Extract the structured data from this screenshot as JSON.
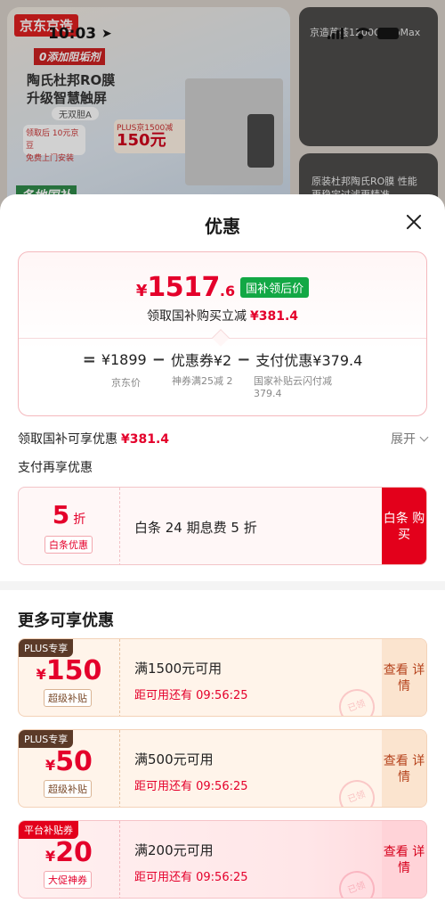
{
  "status_bar": {
    "time": "10:03",
    "location_icon": "location-arrow-icon"
  },
  "background": {
    "brand": "京东京造",
    "zero_tag": "0添加阻垢剂",
    "title": "陶氏杜邦RO膜 升级智慧触屏",
    "sub": "无双胆A",
    "card1": "领取后 10元京豆",
    "card1b": "免费上门安装",
    "card2_label": "PLUS京1500减",
    "card2_amount": "150元",
    "national": "各地国补",
    "right_top": "京造芦荟1200G ProMax",
    "right_bottom": "原装杜邦陶氏RO膜 性能更稳定过滤更精准"
  },
  "sheet": {
    "title": "优惠",
    "summary": {
      "currency": "¥",
      "price_int": "1517",
      "price_dec": ".6",
      "price_tag": "国补领后价",
      "save_label": "领取国补购买立减",
      "save_amount": "¥381.4",
      "formula": {
        "eq": "=",
        "term1": "¥1899",
        "minus1": "−",
        "term2": "优惠券¥2",
        "minus2": "−",
        "term3": "支付优惠¥379.4"
      },
      "labels": {
        "l1": "京东价",
        "l2": "神券满25减 2",
        "l3": "国家补贴云闪付减 379.4"
      }
    },
    "guobu_row": {
      "label": "领取国补可享优惠",
      "amount": "¥381.4",
      "expand": "展开"
    },
    "pay_row": {
      "label": "支付再享优惠"
    },
    "baitiao": {
      "num": "5",
      "unit": "折",
      "badge": "白条优惠",
      "text": "白条 24 期息费 5 折",
      "button": "白条 购买"
    },
    "more_title": "更多可享优惠",
    "coupons": [
      {
        "tag": "PLUS专享",
        "sym": "¥",
        "amount": "150",
        "label": "超级补贴",
        "condition": "满1500元可用",
        "timer": "距可用还有 09:56:25",
        "button": "查看 详情",
        "stamp": "已领"
      },
      {
        "tag": "PLUS专享",
        "sym": "¥",
        "amount": "50",
        "label": "超级补贴",
        "condition": "满500元可用",
        "timer": "距可用还有 09:56:25",
        "button": "查看 详情",
        "stamp": "已领"
      },
      {
        "tag": "平台补贴券",
        "sym": "¥",
        "amount": "20",
        "label": "大促神券",
        "condition": "满200元可用",
        "timer": "距可用还有 09:56:25",
        "button": "查看 详情",
        "stamp": "已领"
      }
    ]
  },
  "colors": {
    "accent": "#e4002b",
    "green_tag": "#12a845",
    "plus_tag": "#5b3a28"
  }
}
